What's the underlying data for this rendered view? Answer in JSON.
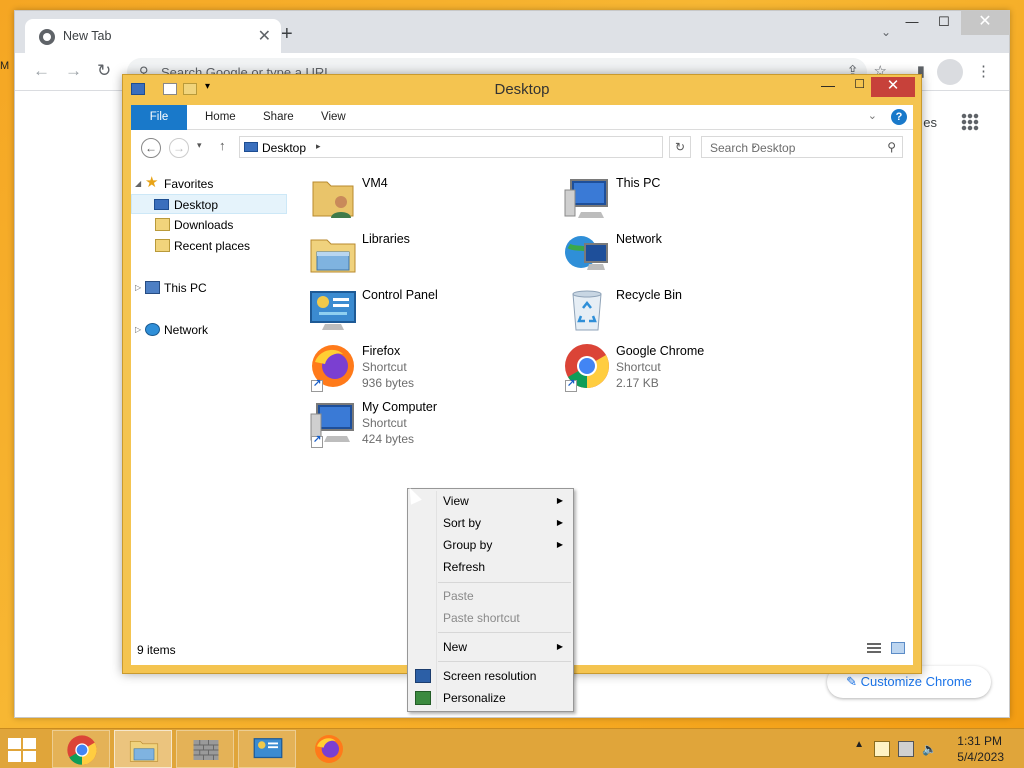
{
  "chrome": {
    "tab_title": "New Tab",
    "new_tab": "+",
    "omnibox_placeholder": "Search Google or type a URL",
    "customize_label": "Customize Chrome",
    "ntp_partial_text": "es",
    "left_snippet": "M"
  },
  "explorer": {
    "title": "Desktop",
    "ribbon_tabs": [
      "File",
      "Home",
      "Share",
      "View"
    ],
    "address": "Desktop",
    "search_placeholder": "Search Desktop",
    "nav": {
      "favorites": "Favorites",
      "desktop": "Desktop",
      "downloads": "Downloads",
      "recent": "Recent places",
      "this_pc": "This PC",
      "network": "Network"
    },
    "items": [
      {
        "name": "VM4",
        "sub1": "",
        "sub2": "",
        "icon": "user-folder-icon"
      },
      {
        "name": "This PC",
        "sub1": "",
        "sub2": "",
        "icon": "computer-icon"
      },
      {
        "name": "Libraries",
        "sub1": "",
        "sub2": "",
        "icon": "libraries-icon"
      },
      {
        "name": "Network",
        "sub1": "",
        "sub2": "",
        "icon": "network-icon"
      },
      {
        "name": "Control Panel",
        "sub1": "",
        "sub2": "",
        "icon": "control-panel-icon"
      },
      {
        "name": "Recycle Bin",
        "sub1": "",
        "sub2": "",
        "icon": "recycle-bin-icon"
      },
      {
        "name": "Firefox",
        "sub1": "Shortcut",
        "sub2": "936 bytes",
        "icon": "firefox-icon"
      },
      {
        "name": "Google Chrome",
        "sub1": "Shortcut",
        "sub2": "2.17 KB",
        "icon": "chrome-icon"
      },
      {
        "name": "My Computer",
        "sub1": "Shortcut",
        "sub2": "424 bytes",
        "icon": "computer-icon"
      }
    ],
    "status": "9 items"
  },
  "context_menu": {
    "view": "View",
    "sort_by": "Sort by",
    "group_by": "Group by",
    "refresh": "Refresh",
    "paste": "Paste",
    "paste_shortcut": "Paste shortcut",
    "new": "New",
    "screen_resolution": "Screen resolution",
    "personalize": "Personalize"
  },
  "taskbar": {
    "time": "1:31 PM",
    "date": "5/4/2023"
  },
  "colors": {
    "desktop_bg": "#f5a623",
    "explorer_frame": "#f4c450",
    "ribbon_file": "#1979ca",
    "close_red": "#c7413a"
  }
}
